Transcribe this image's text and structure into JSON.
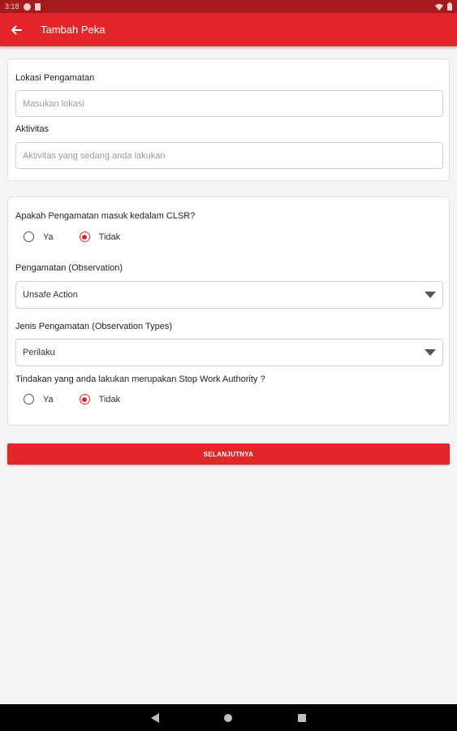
{
  "status_bar": {
    "time": "3:18"
  },
  "app_bar": {
    "title": "Tambah Peka"
  },
  "location_card": {
    "location_label": "Lokasi Pengamatan",
    "location_placeholder": "Masukan lokasi",
    "activity_label": "Aktivitas",
    "activity_placeholder": "Aktivitas yang sedang anda lakukan"
  },
  "observation_card": {
    "clsr_question": "Apakah Pengamatan masuk kedalam CLSR?",
    "clsr_options": {
      "yes": "Ya",
      "no": "Tidak"
    },
    "clsr_selected": "Tidak",
    "observation_label": "Pengamatan (Observation)",
    "observation_value": "Unsafe Action",
    "observation_type_label": "Jenis Pengamatan (Observation Types)",
    "observation_type_value": "Perilaku",
    "swa_question": "Tindakan yang anda lakukan merupakan Stop Work Authority ?",
    "swa_options": {
      "yes": "Ya",
      "no": "Tidak"
    },
    "swa_selected": "Tidak"
  },
  "next_button": {
    "label": "SELANJUTNYA"
  },
  "colors": {
    "primary": "#e3262a",
    "status_bar": "#a51a1a",
    "background": "#f5f5f5"
  },
  "icons": {
    "back": "arrow-left-icon",
    "dropdown": "triangle-down-icon",
    "nav_back": "triangle-left-icon",
    "nav_home": "circle-icon",
    "nav_recent": "square-icon"
  }
}
